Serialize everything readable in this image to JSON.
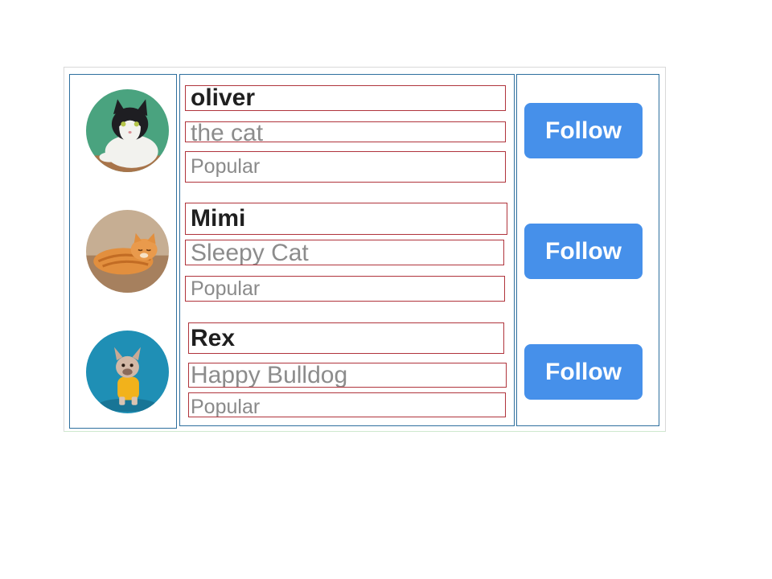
{
  "users": [
    {
      "name": "oliver",
      "description": "the cat",
      "tag": "Popular",
      "follow_label": "Follow",
      "avatar_icon": "tuxedo-cat-avatar-icon",
      "avatar_bg": "#4aa37f"
    },
    {
      "name": "Mimi",
      "description": "Sleepy Cat",
      "tag": "Popular",
      "follow_label": "Follow",
      "avatar_icon": "orange-cat-avatar-icon",
      "avatar_bg": "#b89a7c"
    },
    {
      "name": "Rex",
      "description": "Happy Bulldog",
      "tag": "Popular",
      "follow_label": "Follow",
      "avatar_icon": "bulldog-avatar-icon",
      "avatar_bg": "#1f8fb5"
    }
  ],
  "colors": {
    "button": "#4690ea",
    "name_text": "#1f1f1f",
    "muted_text": "#8c8c8c",
    "column_border": "#2e6f9e",
    "text_box_border": "#b0343c"
  }
}
